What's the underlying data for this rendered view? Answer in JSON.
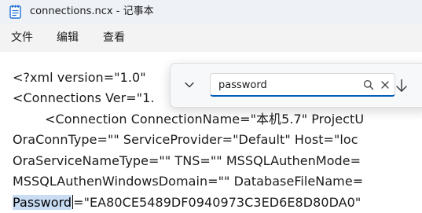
{
  "window": {
    "title": "connections.ncx - 记事本",
    "app_icon": "notepad-icon"
  },
  "menu": {
    "items": [
      {
        "label": "文件"
      },
      {
        "label": "编辑"
      },
      {
        "label": "查看"
      }
    ]
  },
  "editor": {
    "lines": [
      "<?xml version=\"1.0\"",
      "<Connections Ver=\"1.",
      "        <Connection ConnectionName=\"本机5.7\" ProjectU",
      "OraConnType=\"\" ServiceProvider=\"Default\" Host=\"loc",
      "OraServiceNameType=\"\" TNS=\"\" MSSQLAuthenMode=",
      "MSSQLAuthenWindowsDomain=\"\" DatabaseFileName="
    ],
    "match_text": "Password",
    "match_line_rest": "=\"EA80CE5489DF0940973C3ED6E8D80DA0\""
  },
  "find": {
    "query": "password",
    "icons": {
      "expand": "chevron-down-icon",
      "search": "search-icon",
      "clear": "close-icon",
      "next": "arrow-down-icon"
    }
  },
  "colors": {
    "match_highlight": "#c8ddf4",
    "focus_accent": "#005fb8"
  }
}
